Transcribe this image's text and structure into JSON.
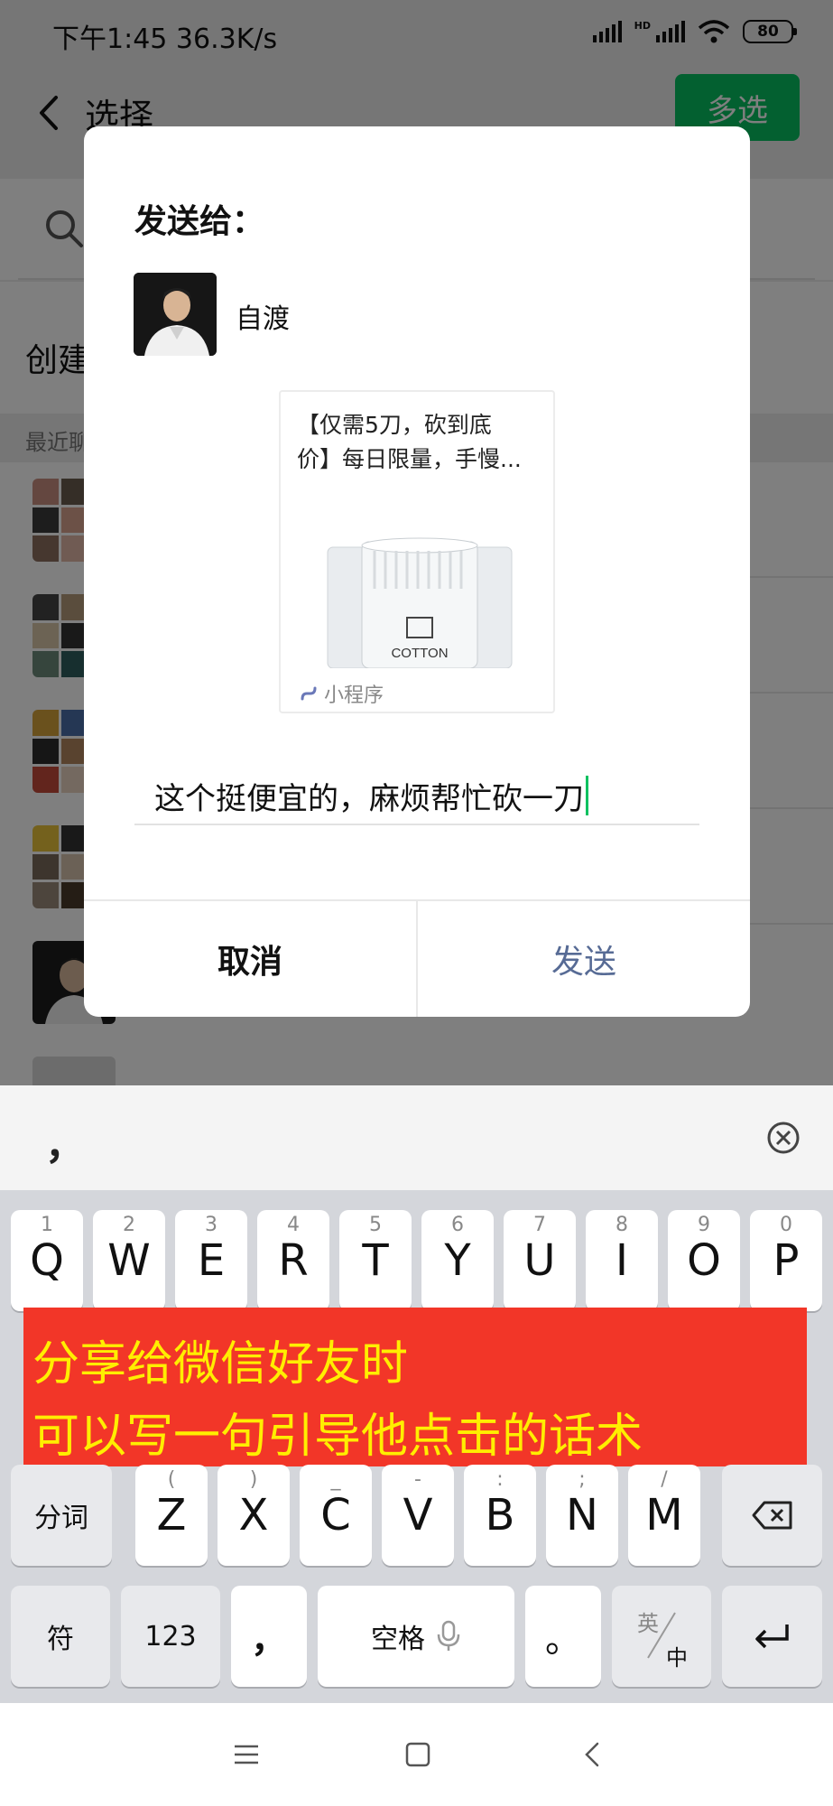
{
  "status_bar": {
    "time_speed": "下午1:45 36.3K/s",
    "hd_label": "HD",
    "battery": "80"
  },
  "nav": {
    "title": "选择",
    "multi_select": "多选"
  },
  "background_list": {
    "create_label": "创建",
    "recent_label": "最近聊"
  },
  "dialog": {
    "title": "发送给：",
    "recipient_name": "自渡",
    "card": {
      "title": "【仅需5刀，砍到底\n价】每日限量，手慢...",
      "image_text": "COTTON",
      "footer": "小程序"
    },
    "message": "这个挺便宜的，麻烦帮忙砍一刀",
    "cancel": "取消",
    "send": "发送"
  },
  "keyboard": {
    "candidate": "，",
    "row1": [
      {
        "letter": "Q",
        "sub": "1"
      },
      {
        "letter": "W",
        "sub": "2"
      },
      {
        "letter": "E",
        "sub": "3"
      },
      {
        "letter": "R",
        "sub": "4"
      },
      {
        "letter": "T",
        "sub": "5"
      },
      {
        "letter": "Y",
        "sub": "6"
      },
      {
        "letter": "U",
        "sub": "7"
      },
      {
        "letter": "I",
        "sub": "8"
      },
      {
        "letter": "O",
        "sub": "9"
      },
      {
        "letter": "P",
        "sub": "0"
      }
    ],
    "row3": {
      "split": "分词",
      "keys": [
        {
          "letter": "Z",
          "sub": "("
        },
        {
          "letter": "X",
          "sub": ")"
        },
        {
          "letter": "C",
          "sub": "_"
        },
        {
          "letter": "V",
          "sub": "-"
        },
        {
          "letter": "B",
          "sub": ":"
        },
        {
          "letter": "N",
          "sub": ";"
        },
        {
          "letter": "M",
          "sub": "/"
        }
      ]
    },
    "row4": {
      "symbols": "符",
      "numbers": "123",
      "comma": "，",
      "space": "空格",
      "period": "。",
      "lang_en": "英",
      "lang_zh": "中"
    }
  },
  "tip_banner": {
    "line1": "分享给微信好友时",
    "line2": "可以写一句引导他点击的话术"
  },
  "colors": {
    "wechat_green": "#07c160",
    "link_blue": "#576b95",
    "banner_red": "#f23628",
    "banner_text": "#ffee00"
  }
}
